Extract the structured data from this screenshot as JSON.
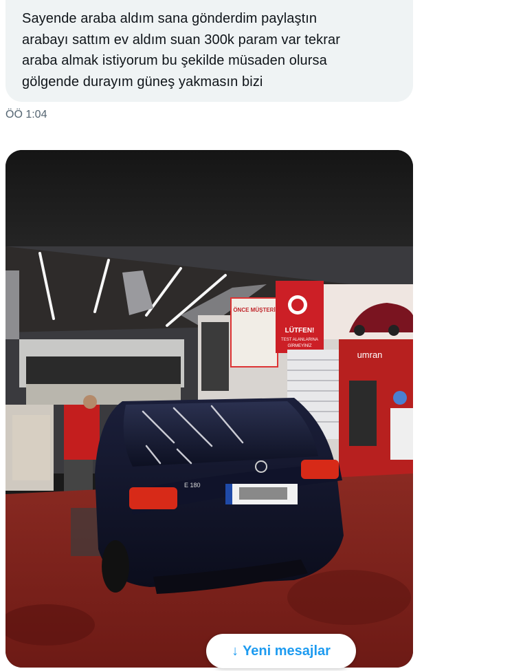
{
  "message": {
    "lines": [
      "Sayende araba aldım sana gönderdim paylaştın",
      "arabayı sattım ev aldım suan 300k param var tekrar",
      "araba almak istiyorum bu şekilde müsaden olursa",
      "gölgende durayım güneş yakmasın bizi"
    ],
    "timestamp": "ÖÖ 1:04"
  },
  "photo": {
    "description_icon": "photo-attachment",
    "signs": {
      "once_musteri": "ÖNCE MÜŞTERİ",
      "lutfen": "LÜTFEN!",
      "test_alanlarina": "TEST ALANLARINA",
      "girmeyiniz": "GİRMEYİNİZ",
      "brand": "umran",
      "trunk_badge": "E 180"
    }
  },
  "new_messages_button": {
    "arrow": "↓",
    "label": "Yeni mesajlar"
  },
  "colors": {
    "bubble_bg": "#eff3f4",
    "text": "#0f1419",
    "timestamp": "#536471",
    "accent": "#1d9bf0"
  }
}
